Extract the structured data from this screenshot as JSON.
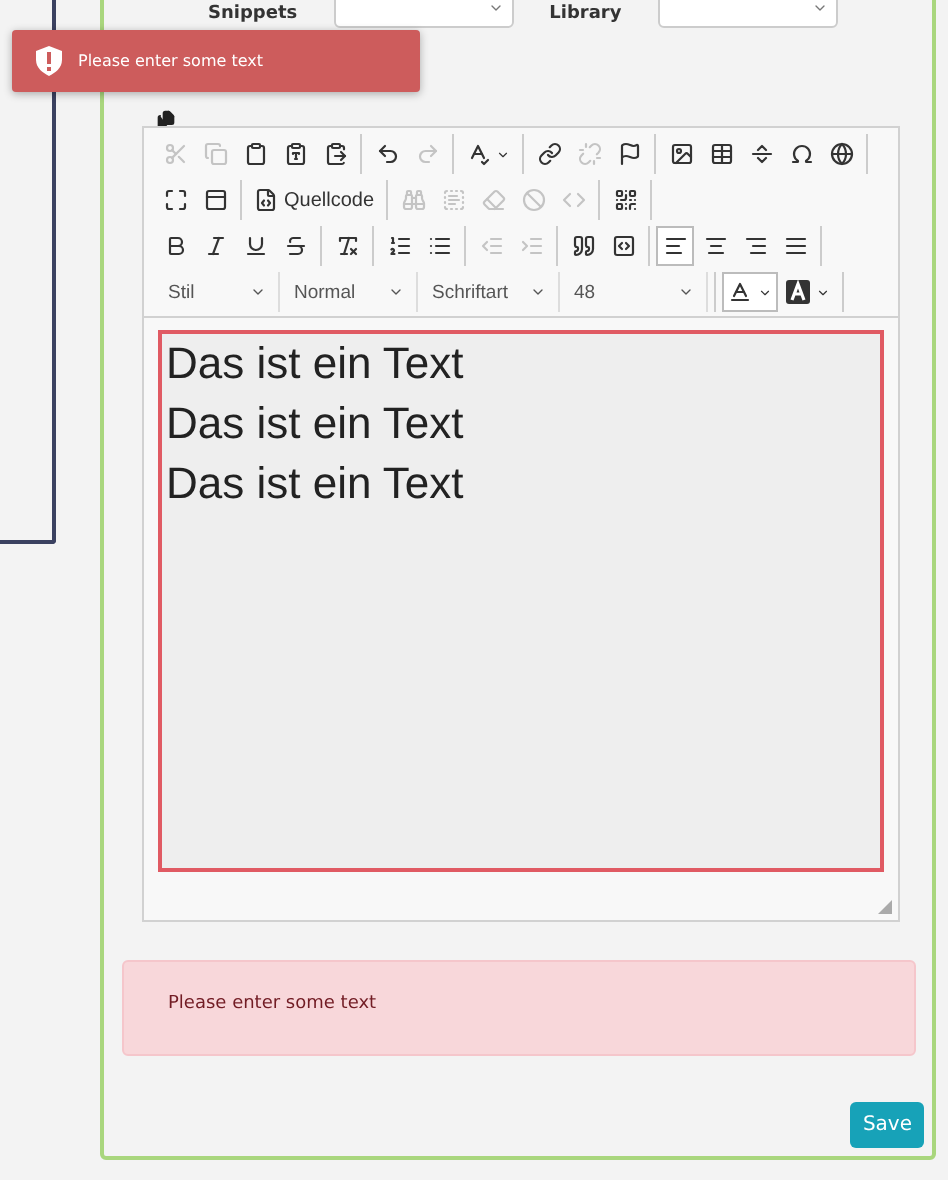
{
  "toast": {
    "message": "Please enter some text"
  },
  "filters": [
    {
      "label": "Snippets"
    },
    {
      "label": "Library"
    }
  ],
  "editor": {
    "toolbar": [
      [
        [
          {
            "kind": "button",
            "disabled": true,
            "selected": false
          },
          {
            "kind": "button",
            "disabled": true,
            "selected": false
          },
          {
            "kind": "button",
            "disabled": false,
            "selected": false
          },
          {
            "kind": "button",
            "disabled": false,
            "selected": false
          },
          {
            "kind": "button",
            "disabled": false,
            "selected": false
          }
        ],
        [
          {
            "kind": "button",
            "disabled": false,
            "selected": false
          },
          {
            "kind": "button",
            "disabled": true,
            "selected": false
          }
        ],
        [
          {
            "kind": "menu",
            "disabled": false,
            "selected": false
          }
        ],
        [
          {
            "kind": "button",
            "disabled": false,
            "selected": false
          },
          {
            "kind": "button",
            "disabled": true,
            "selected": false
          },
          {
            "kind": "button",
            "disabled": false,
            "selected": false
          }
        ],
        [
          {
            "kind": "button",
            "disabled": false,
            "selected": false
          },
          {
            "kind": "button",
            "disabled": false,
            "selected": false
          },
          {
            "kind": "button",
            "disabled": false,
            "selected": false
          },
          {
            "kind": "button",
            "disabled": false,
            "selected": false
          },
          {
            "kind": "button",
            "disabled": false,
            "selected": false
          }
        ]
      ],
      [
        [
          {
            "kind": "button",
            "disabled": false,
            "selected": false
          },
          {
            "kind": "button",
            "disabled": false,
            "selected": false
          }
        ],
        [
          {
            "kind": "button",
            "disabled": false,
            "selected": false,
            "label": "Quellcode"
          }
        ],
        [
          {
            "kind": "button",
            "disabled": true,
            "selected": false
          },
          {
            "kind": "button",
            "disabled": true,
            "selected": false
          },
          {
            "kind": "button",
            "disabled": true,
            "selected": false
          },
          {
            "kind": "button",
            "disabled": true,
            "selected": false
          },
          {
            "kind": "button",
            "disabled": true,
            "selected": false
          }
        ],
        [
          {
            "kind": "button",
            "disabled": false,
            "selected": false
          }
        ]
      ],
      [
        [
          {
            "kind": "button",
            "disabled": false,
            "selected": false
          },
          {
            "kind": "button",
            "disabled": false,
            "selected": false
          },
          {
            "kind": "button",
            "disabled": false,
            "selected": false
          },
          {
            "kind": "button",
            "disabled": false,
            "selected": false
          }
        ],
        [
          {
            "kind": "button",
            "disabled": false,
            "selected": false
          }
        ],
        [
          {
            "kind": "button",
            "disabled": false,
            "selected": false
          },
          {
            "kind": "button",
            "disabled": false,
            "selected": false
          }
        ],
        [
          {
            "kind": "button",
            "disabled": true,
            "selected": false
          },
          {
            "kind": "button",
            "disabled": true,
            "selected": false
          }
        ],
        [
          {
            "kind": "button",
            "disabled": false,
            "selected": false
          },
          {
            "kind": "button",
            "disabled": false,
            "selected": false
          }
        ],
        [
          {
            "kind": "button",
            "disabled": false,
            "selected": true
          },
          {
            "kind": "button",
            "disabled": false,
            "selected": false
          },
          {
            "kind": "button",
            "disabled": false,
            "selected": false
          },
          {
            "kind": "button",
            "disabled": false,
            "selected": false
          }
        ]
      ],
      [
        [
          {
            "kind": "combo",
            "label": "Stil"
          },
          {
            "kind": "combo",
            "label": "Normal"
          },
          {
            "kind": "combo",
            "label": "Schriftart"
          },
          {
            "kind": "combo",
            "label": "48"
          }
        ],
        [
          {
            "kind": "menu",
            "disabled": false,
            "selected": true
          },
          {
            "kind": "menu",
            "disabled": false,
            "selected": false
          }
        ]
      ]
    ],
    "content": [
      "Das ist ein Text",
      "Das ist ein Text",
      "Das ist ein Text"
    ],
    "invalid": true
  },
  "alert": {
    "message": "Please enter some text"
  },
  "buttons": [
    {
      "label": "Save"
    }
  ]
}
